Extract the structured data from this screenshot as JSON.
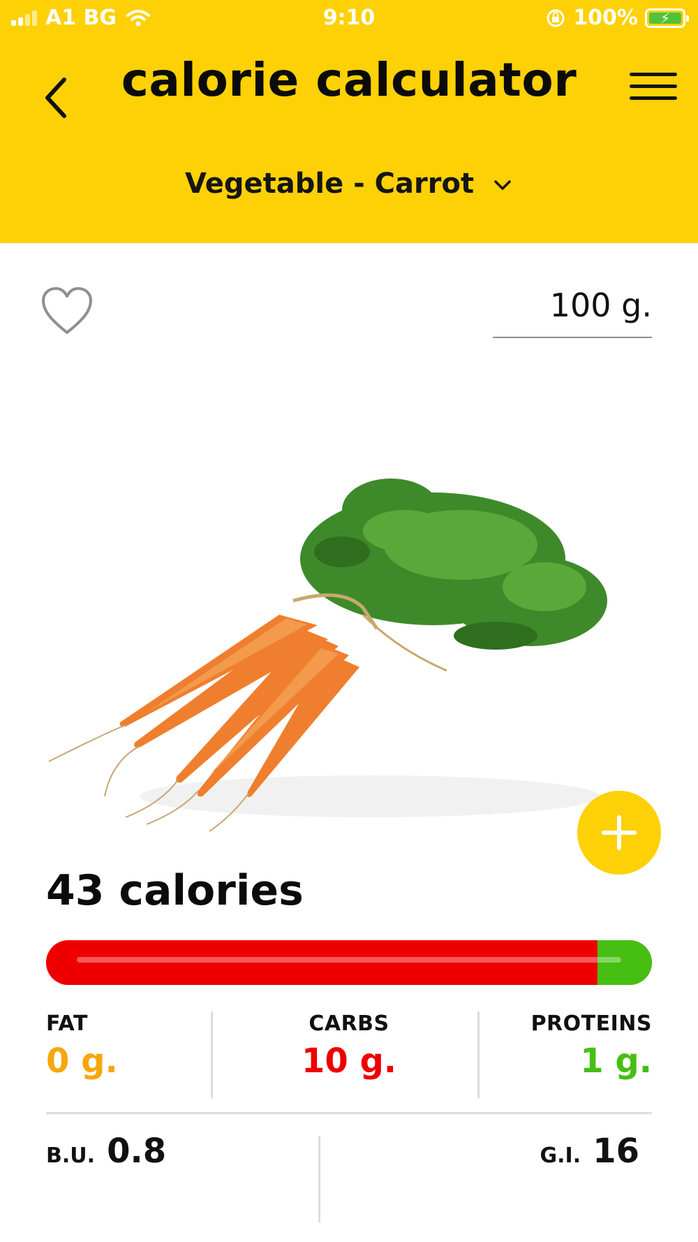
{
  "status_bar": {
    "carrier": "A1 BG",
    "time": "9:10",
    "battery": "100%"
  },
  "header": {
    "title": "calorie calculator",
    "selector": "Vegetable - Carrot"
  },
  "weight": {
    "value": "100 g."
  },
  "food": {
    "image": "carrot-bunch-image"
  },
  "nutrition": {
    "calories": "43 calories",
    "bar": {
      "carbs_fraction": 0.91,
      "protein_fraction": 0.09,
      "fat_fraction": 0.0
    },
    "fat": {
      "label": "FAT",
      "value": "0 g.",
      "color": "#f5a80c"
    },
    "carbs": {
      "label": "CARBS",
      "value": "10 g.",
      "color": "#ee0000"
    },
    "proteins": {
      "label": "PROTEINS",
      "value": "1 g.",
      "color": "#46bf12"
    },
    "bu": {
      "label": "B.U.",
      "value": "0.8"
    },
    "gi": {
      "label": "G.I.",
      "value": "16"
    }
  },
  "colors": {
    "header": "#fdd106",
    "accent": "#fdd106"
  }
}
